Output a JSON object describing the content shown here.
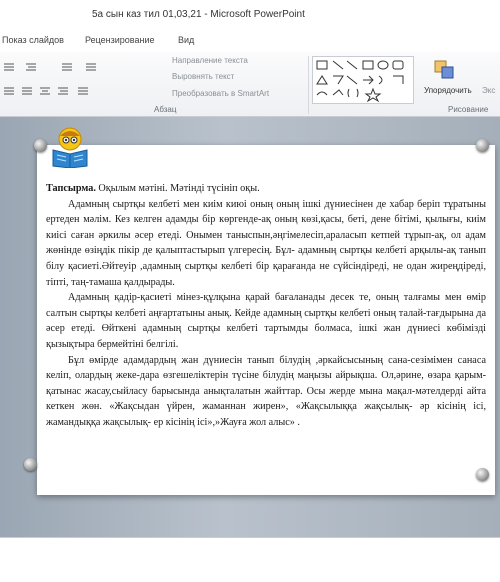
{
  "window": {
    "title": "5а сын каз тил 01,03,21  -  Microsoft PowerPoint"
  },
  "tabs": [
    "Показ слайдов",
    "Рецензирование",
    "Вид"
  ],
  "ribbon": {
    "text_direction": "Направление текста",
    "align_text": "Выровнять текст",
    "convert_smartart": "Преобразовать в SmartArt",
    "arrange": "Упорядочить",
    "quick_styles": "Экс",
    "group_paragraph": "Абзац",
    "group_drawing": "Рисование"
  },
  "slide": {
    "task_label": "Тапсырма.",
    "task_rest": " Оқылым мәтіні.  Мәтінді  түсініп оқы.",
    "paragraphs": [
      "Адамның сыртқы келбеті мен киім  киюі оның оның ішкі  дүниесінен де хабар беріп тұратыны ертеден мәлім. Кез келген адамды бір  көргенде-ақ оның көзі,қасы, беті, дене бітімі,  қылығы, киім  киісі  саған әркилы әсер етеді.  Онымен таныспын,әңгімелесіп,араласып кетпей тұрып-ақ, ол адам жөнінде өзіңдік  пікір  де қалыптастырып үлгересің.  Бұл- адамның сыртқы келбеті арқылы-ақ танып білу қасиеті.Әйтеуір  ,адамның сыртқы келбеті бір қарағанда не сүйсіндіреді,  не одан жиреңдіреді, тіпті,  таң-тамаша қалдырады.",
      "Адамның қадір-қасиеті мінез-құлқына қарай бағаланады десек те, оның талғамы мен өмір салтын сыртқы келбеті аңғартатыны анық. Кейде адамның сыртқы келбеті оның талай-тағдырына да әсер етеді.  Өйткені адамның сыртқы келбеті тартымды болмаса, ішкі  жан дүниесі көбімізді  қызықтыра бермейтіні белгілі.",
      "Бұл өмірде адамдардың жан дүниесін танып білудің  ,әркайсысының сана-сезімімен санаса келіп, олардың жеке-дара өзгешеліктерін  түсіне білудің маңызы айрықша.  Ол,әрине, өзара қарым-қатынас жасау,сыйласу барысында анықталатын жайттар. Осы жерде мына мақал-мәтелдерді айта кеткен жөн. «Жақсыдан үйрен, жаманнан жирен», «Жақсылыққа жақсылық- әр кісінің  ісі, жамандыққа жақсылық- ер кісінің  ісі»,»Жауға  жол алыс» ."
    ]
  }
}
